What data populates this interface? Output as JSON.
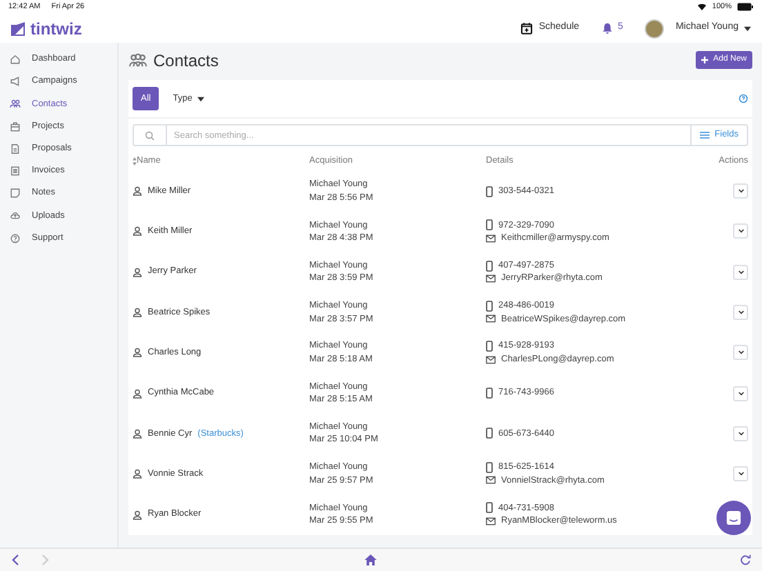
{
  "status_bar": {
    "time": "12:42 AM",
    "date": "Fri Apr 26",
    "battery": "100%"
  },
  "header": {
    "logo": "tintwiz",
    "schedule": "Schedule",
    "notifications": "5",
    "user": "Michael Young"
  },
  "sidebar": {
    "items": [
      {
        "label": "Dashboard",
        "selected": false
      },
      {
        "label": "Campaigns",
        "selected": false
      },
      {
        "label": "Contacts",
        "selected": true
      },
      {
        "label": "Projects",
        "selected": false
      },
      {
        "label": "Proposals",
        "selected": false
      },
      {
        "label": "Invoices",
        "selected": false
      },
      {
        "label": "Notes",
        "selected": false
      },
      {
        "label": "Uploads",
        "selected": false
      },
      {
        "label": "Support",
        "selected": false
      }
    ]
  },
  "page_title": "Contacts",
  "add_button": "Add New",
  "filters": [
    {
      "label": "All",
      "selected": true,
      "kind": "button"
    },
    {
      "label": "Type",
      "selected": false,
      "kind": "dropdown"
    }
  ],
  "search": {
    "placeholder": "Search something...",
    "fields_button": "Fields"
  },
  "table": {
    "columns": [
      "Name",
      "Acquisition",
      "Details",
      "Actions"
    ],
    "rows": [
      {
        "name": "Mike Miller",
        "acquired_by": "Michael Young",
        "acquired_at": "Mar 28 5:56 PM",
        "phone": "303-544-0321"
      },
      {
        "name": "Keith Miller",
        "acquired_by": "Michael Young",
        "acquired_at": "Mar 28 4:38 PM",
        "phone": "972-329-7090",
        "email": "Keithcmiller@armyspy.com"
      },
      {
        "name": "Jerry Parker",
        "acquired_by": "Michael Young",
        "acquired_at": "Mar 28 3:59 PM",
        "phone": "407-497-2875",
        "email": "JerryRParker@rhyta.com"
      },
      {
        "name": "Beatrice Spikes",
        "acquired_by": "Michael Young",
        "acquired_at": "Mar 28 3:57 PM",
        "phone": "248-486-0019",
        "email": "BeatriceWSpikes@dayrep.com"
      },
      {
        "name": "Charles Long",
        "acquired_by": "Michael Young",
        "acquired_at": "Mar 28 5:18 AM",
        "phone": "415-928-9193",
        "email": "CharlesPLong@dayrep.com"
      },
      {
        "name": "Cynthia McCabe",
        "acquired_by": "Michael Young",
        "acquired_at": "Mar 28 5:15 AM",
        "phone": "716-743-9966"
      },
      {
        "name": "Bennie Cyr",
        "company": "(Starbucks)",
        "acquired_by": "Michael Young",
        "acquired_at": "Mar 25 10:04 PM",
        "phone": "605-673-6440"
      },
      {
        "name": "Vonnie Strack",
        "acquired_by": "Michael Young",
        "acquired_at": "Mar 25 9:57 PM",
        "phone": "815-625-1614",
        "email": "VonnielStrack@rhyta.com"
      },
      {
        "name": "Ryan Blocker",
        "acquired_by": "Michael Young",
        "acquired_at": "Mar 25 9:55 PM",
        "phone": "404-731-5908",
        "email": "RyanMBlocker@teleworm.us"
      }
    ]
  }
}
